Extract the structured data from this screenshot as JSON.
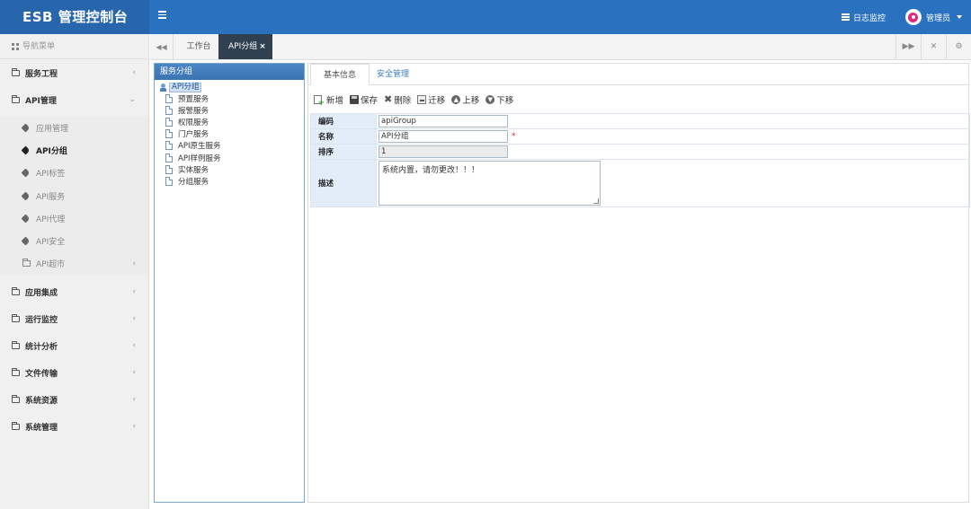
{
  "app": {
    "title": "ESB 管理控制台",
    "log_monitor": "日志监控",
    "user": "管理员"
  },
  "sidebar": {
    "header": "导航菜单",
    "groups": [
      {
        "label": "服务工程",
        "chev": "‹"
      },
      {
        "label": "API管理",
        "chev": "⌄"
      },
      {
        "label": "应用集成",
        "chev": "‹"
      },
      {
        "label": "运行监控",
        "chev": "‹"
      },
      {
        "label": "统计分析",
        "chev": "‹"
      },
      {
        "label": "文件传输",
        "chev": "‹"
      },
      {
        "label": "系统资源",
        "chev": "‹"
      },
      {
        "label": "系统管理",
        "chev": "‹"
      }
    ],
    "api_items": [
      {
        "label": "应用管理"
      },
      {
        "label": "API分组"
      },
      {
        "label": "API标签"
      },
      {
        "label": "API服务"
      },
      {
        "label": "API代理"
      },
      {
        "label": "API安全"
      },
      {
        "label": "API超市",
        "chev": "‹"
      }
    ]
  },
  "tabs": {
    "nav_left": "◀◀",
    "workbench": "工作台",
    "active": "API分组",
    "close": "×",
    "tools": [
      "▶▶",
      "✕",
      "⚙"
    ]
  },
  "tree": {
    "title": "服务分组",
    "root": "API分组",
    "children": [
      "预置服务",
      "报警服务",
      "权限服务",
      "门户服务",
      "API原生服务",
      "API样例服务",
      "实体服务",
      "分组服务"
    ]
  },
  "form": {
    "tabs": {
      "basic": "基本信息",
      "security": "安全管理"
    },
    "toolbar": {
      "new": "新增",
      "save": "保存",
      "delete": "删除",
      "move": "迁移",
      "up": "上移",
      "down": "下移"
    },
    "fields": {
      "code_label": "编码",
      "code_value": "apiGroup",
      "name_label": "名称",
      "name_value": "API分组",
      "required": "*",
      "order_label": "排序",
      "order_value": "1",
      "desc_label": "描述",
      "desc_value": "系统内置，请勿更改！！！"
    }
  }
}
